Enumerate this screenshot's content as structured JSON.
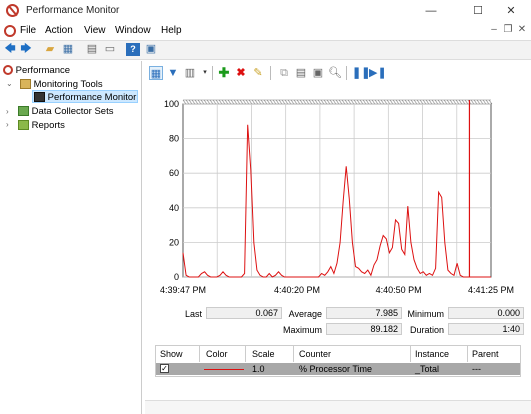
{
  "window": {
    "title": "Performance Monitor",
    "minimize_glyph": "—",
    "maximize_glyph": "☐",
    "close_glyph": "✕"
  },
  "menu": {
    "items": [
      "File",
      "Action",
      "View",
      "Window",
      "Help"
    ]
  },
  "tree": {
    "root": "Performance",
    "monitoring_tools": "Monitoring Tools",
    "performance_monitor": "Performance Monitor",
    "data_collector_sets": "Data Collector Sets",
    "reports": "Reports"
  },
  "stats": {
    "last_label": "Last",
    "last_value": "0.067",
    "average_label": "Average",
    "average_value": "7.985",
    "minimum_label": "Minimum",
    "minimum_value": "0.000",
    "maximum_label": "Maximum",
    "maximum_value": "89.182",
    "duration_label": "Duration",
    "duration_value": "1:40"
  },
  "legend": {
    "headers": [
      "Show",
      "Color",
      "Scale",
      "Counter",
      "Instance",
      "Parent"
    ],
    "row": {
      "show": "✓",
      "scale": "1.0",
      "counter": "% Processor Time",
      "instance": "_Total",
      "parent": "---"
    }
  },
  "colors": {
    "series": "#d11",
    "selection": "#cde8ff",
    "legend_row": "#a8a8a8"
  },
  "chart_data": {
    "type": "line",
    "ylim": [
      0,
      100
    ],
    "yticks": [
      0,
      20,
      40,
      60,
      80,
      100
    ],
    "xtick_labels": [
      "4:39:47 PM",
      "4:40:20 PM",
      "4:40:50 PM",
      "4:41:25 PM"
    ],
    "grid": true,
    "series": [
      {
        "values": [
          14,
          1,
          0,
          0,
          0,
          0,
          2,
          3,
          1,
          0,
          0,
          0,
          1,
          3,
          1,
          0,
          0,
          0,
          0,
          0,
          2,
          88,
          62,
          20,
          4,
          1,
          0,
          0,
          2,
          0,
          1,
          3,
          1,
          0,
          0,
          0,
          0,
          0,
          0,
          0,
          0,
          0,
          0,
          0,
          0,
          2,
          1,
          3,
          6,
          2,
          8,
          20,
          44,
          64,
          45,
          20,
          6,
          5,
          3,
          2,
          4,
          1,
          7,
          10,
          18,
          24,
          22,
          14,
          17,
          33,
          31,
          16,
          13,
          41,
          20,
          10,
          5,
          2,
          3,
          1,
          2,
          1,
          5,
          49,
          46,
          20,
          4,
          2,
          1,
          8,
          1,
          0,
          0,
          0,
          0,
          0,
          0,
          0,
          0,
          0,
          0
        ],
        "cursor_index": 93
      }
    ]
  }
}
